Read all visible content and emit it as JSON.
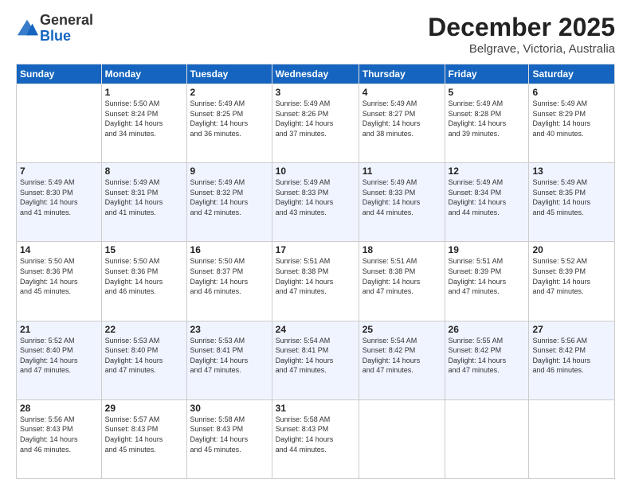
{
  "logo": {
    "general": "General",
    "blue": "Blue"
  },
  "header": {
    "month": "December 2025",
    "location": "Belgrave, Victoria, Australia"
  },
  "weekdays": [
    "Sunday",
    "Monday",
    "Tuesday",
    "Wednesday",
    "Thursday",
    "Friday",
    "Saturday"
  ],
  "weeks": [
    [
      {
        "day": "",
        "sunrise": "",
        "sunset": "",
        "daylight": ""
      },
      {
        "day": "1",
        "sunrise": "Sunrise: 5:50 AM",
        "sunset": "Sunset: 8:24 PM",
        "daylight": "Daylight: 14 hours and 34 minutes."
      },
      {
        "day": "2",
        "sunrise": "Sunrise: 5:49 AM",
        "sunset": "Sunset: 8:25 PM",
        "daylight": "Daylight: 14 hours and 36 minutes."
      },
      {
        "day": "3",
        "sunrise": "Sunrise: 5:49 AM",
        "sunset": "Sunset: 8:26 PM",
        "daylight": "Daylight: 14 hours and 37 minutes."
      },
      {
        "day": "4",
        "sunrise": "Sunrise: 5:49 AM",
        "sunset": "Sunset: 8:27 PM",
        "daylight": "Daylight: 14 hours and 38 minutes."
      },
      {
        "day": "5",
        "sunrise": "Sunrise: 5:49 AM",
        "sunset": "Sunset: 8:28 PM",
        "daylight": "Daylight: 14 hours and 39 minutes."
      },
      {
        "day": "6",
        "sunrise": "Sunrise: 5:49 AM",
        "sunset": "Sunset: 8:29 PM",
        "daylight": "Daylight: 14 hours and 40 minutes."
      }
    ],
    [
      {
        "day": "7",
        "sunrise": "Sunrise: 5:49 AM",
        "sunset": "Sunset: 8:30 PM",
        "daylight": "Daylight: 14 hours and 41 minutes."
      },
      {
        "day": "8",
        "sunrise": "Sunrise: 5:49 AM",
        "sunset": "Sunset: 8:31 PM",
        "daylight": "Daylight: 14 hours and 41 minutes."
      },
      {
        "day": "9",
        "sunrise": "Sunrise: 5:49 AM",
        "sunset": "Sunset: 8:32 PM",
        "daylight": "Daylight: 14 hours and 42 minutes."
      },
      {
        "day": "10",
        "sunrise": "Sunrise: 5:49 AM",
        "sunset": "Sunset: 8:33 PM",
        "daylight": "Daylight: 14 hours and 43 minutes."
      },
      {
        "day": "11",
        "sunrise": "Sunrise: 5:49 AM",
        "sunset": "Sunset: 8:33 PM",
        "daylight": "Daylight: 14 hours and 44 minutes."
      },
      {
        "day": "12",
        "sunrise": "Sunrise: 5:49 AM",
        "sunset": "Sunset: 8:34 PM",
        "daylight": "Daylight: 14 hours and 44 minutes."
      },
      {
        "day": "13",
        "sunrise": "Sunrise: 5:49 AM",
        "sunset": "Sunset: 8:35 PM",
        "daylight": "Daylight: 14 hours and 45 minutes."
      }
    ],
    [
      {
        "day": "14",
        "sunrise": "Sunrise: 5:50 AM",
        "sunset": "Sunset: 8:36 PM",
        "daylight": "Daylight: 14 hours and 45 minutes."
      },
      {
        "day": "15",
        "sunrise": "Sunrise: 5:50 AM",
        "sunset": "Sunset: 8:36 PM",
        "daylight": "Daylight: 14 hours and 46 minutes."
      },
      {
        "day": "16",
        "sunrise": "Sunrise: 5:50 AM",
        "sunset": "Sunset: 8:37 PM",
        "daylight": "Daylight: 14 hours and 46 minutes."
      },
      {
        "day": "17",
        "sunrise": "Sunrise: 5:51 AM",
        "sunset": "Sunset: 8:38 PM",
        "daylight": "Daylight: 14 hours and 47 minutes."
      },
      {
        "day": "18",
        "sunrise": "Sunrise: 5:51 AM",
        "sunset": "Sunset: 8:38 PM",
        "daylight": "Daylight: 14 hours and 47 minutes."
      },
      {
        "day": "19",
        "sunrise": "Sunrise: 5:51 AM",
        "sunset": "Sunset: 8:39 PM",
        "daylight": "Daylight: 14 hours and 47 minutes."
      },
      {
        "day": "20",
        "sunrise": "Sunrise: 5:52 AM",
        "sunset": "Sunset: 8:39 PM",
        "daylight": "Daylight: 14 hours and 47 minutes."
      }
    ],
    [
      {
        "day": "21",
        "sunrise": "Sunrise: 5:52 AM",
        "sunset": "Sunset: 8:40 PM",
        "daylight": "Daylight: 14 hours and 47 minutes."
      },
      {
        "day": "22",
        "sunrise": "Sunrise: 5:53 AM",
        "sunset": "Sunset: 8:40 PM",
        "daylight": "Daylight: 14 hours and 47 minutes."
      },
      {
        "day": "23",
        "sunrise": "Sunrise: 5:53 AM",
        "sunset": "Sunset: 8:41 PM",
        "daylight": "Daylight: 14 hours and 47 minutes."
      },
      {
        "day": "24",
        "sunrise": "Sunrise: 5:54 AM",
        "sunset": "Sunset: 8:41 PM",
        "daylight": "Daylight: 14 hours and 47 minutes."
      },
      {
        "day": "25",
        "sunrise": "Sunrise: 5:54 AM",
        "sunset": "Sunset: 8:42 PM",
        "daylight": "Daylight: 14 hours and 47 minutes."
      },
      {
        "day": "26",
        "sunrise": "Sunrise: 5:55 AM",
        "sunset": "Sunset: 8:42 PM",
        "daylight": "Daylight: 14 hours and 47 minutes."
      },
      {
        "day": "27",
        "sunrise": "Sunrise: 5:56 AM",
        "sunset": "Sunset: 8:42 PM",
        "daylight": "Daylight: 14 hours and 46 minutes."
      }
    ],
    [
      {
        "day": "28",
        "sunrise": "Sunrise: 5:56 AM",
        "sunset": "Sunset: 8:43 PM",
        "daylight": "Daylight: 14 hours and 46 minutes."
      },
      {
        "day": "29",
        "sunrise": "Sunrise: 5:57 AM",
        "sunset": "Sunset: 8:43 PM",
        "daylight": "Daylight: 14 hours and 45 minutes."
      },
      {
        "day": "30",
        "sunrise": "Sunrise: 5:58 AM",
        "sunset": "Sunset: 8:43 PM",
        "daylight": "Daylight: 14 hours and 45 minutes."
      },
      {
        "day": "31",
        "sunrise": "Sunrise: 5:58 AM",
        "sunset": "Sunset: 8:43 PM",
        "daylight": "Daylight: 14 hours and 44 minutes."
      },
      {
        "day": "",
        "sunrise": "",
        "sunset": "",
        "daylight": ""
      },
      {
        "day": "",
        "sunrise": "",
        "sunset": "",
        "daylight": ""
      },
      {
        "day": "",
        "sunrise": "",
        "sunset": "",
        "daylight": ""
      }
    ]
  ]
}
